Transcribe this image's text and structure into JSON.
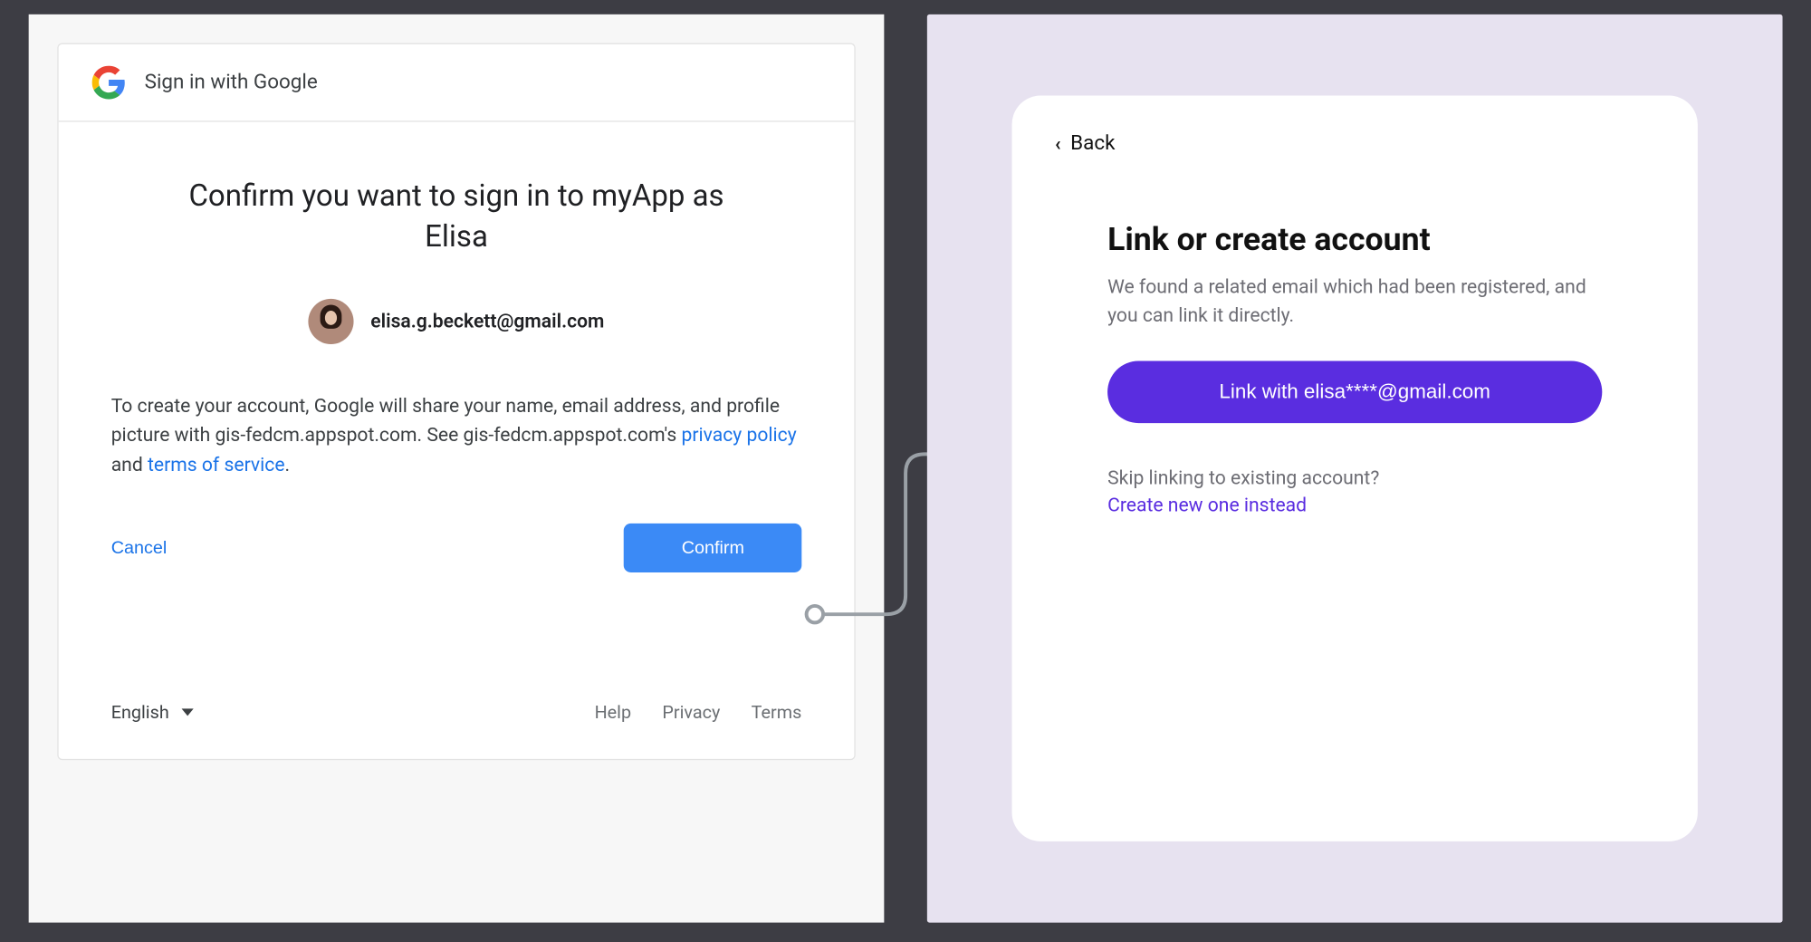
{
  "google": {
    "header_label": "Sign in with Google",
    "title": "Confirm you want to sign in to myApp as Elisa",
    "email": "elisa.g.beckett@gmail.com",
    "consent_pre": "To create your account, Google will share your name, email address, and profile picture with gis-fedcm.appspot.com. See gis-fedcm.appspot.com's ",
    "privacy_label": "privacy policy",
    "consent_mid": " and ",
    "terms_label": "terms of service",
    "consent_end": ".",
    "cancel_label": "Cancel",
    "confirm_label": "Confirm",
    "language": "English",
    "footer_help": "Help",
    "footer_privacy": "Privacy",
    "footer_terms": "Terms"
  },
  "app": {
    "back_label": "Back",
    "title": "Link or create account",
    "description": "We found a related email which had been registered, and you can link it directly.",
    "link_button": "Link with elisa****@gmail.com",
    "skip_label": "Skip linking to existing account?",
    "create_label": "Create new one instead"
  }
}
